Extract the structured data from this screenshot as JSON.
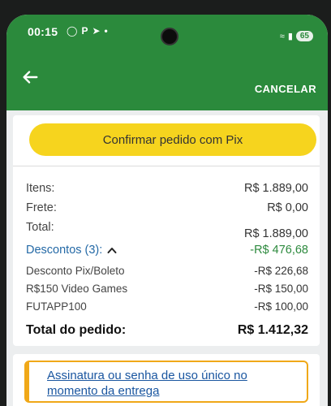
{
  "status_bar": {
    "time": "00:15",
    "battery": "65"
  },
  "app_bar": {
    "cancel_label": "CANCELAR"
  },
  "confirm_button": {
    "label": "Confirmar pedido com Pix",
    "color": "#f6d41e"
  },
  "summary": {
    "items_label": "Itens:",
    "items_value": "R$ 1.889,00",
    "shipping_label": "Frete:",
    "shipping_value": "R$ 0,00",
    "total_label": "Total:",
    "total_value": "R$ 1.889,00",
    "discounts_label": "Descontos (3):",
    "discounts_value": "-R$ 476,68",
    "discounts": [
      {
        "label": "Desconto Pix/Boleto",
        "value": "-R$ 226,68"
      },
      {
        "label": "R$150 Video Games",
        "value": "-R$ 150,00"
      },
      {
        "label": "FUTAPP100",
        "value": "-R$ 100,00"
      }
    ],
    "order_total_label": "Total do pedido:",
    "order_total_value": "R$ 1.412,32"
  },
  "signature": {
    "link_text": "Assinatura ou senha de uso único no momento da entrega"
  },
  "colors": {
    "header_green": "#2b8a3c",
    "discount_green": "#2d8a3e",
    "link_blue": "#1a56a0",
    "alert_orange": "#f0a818"
  }
}
